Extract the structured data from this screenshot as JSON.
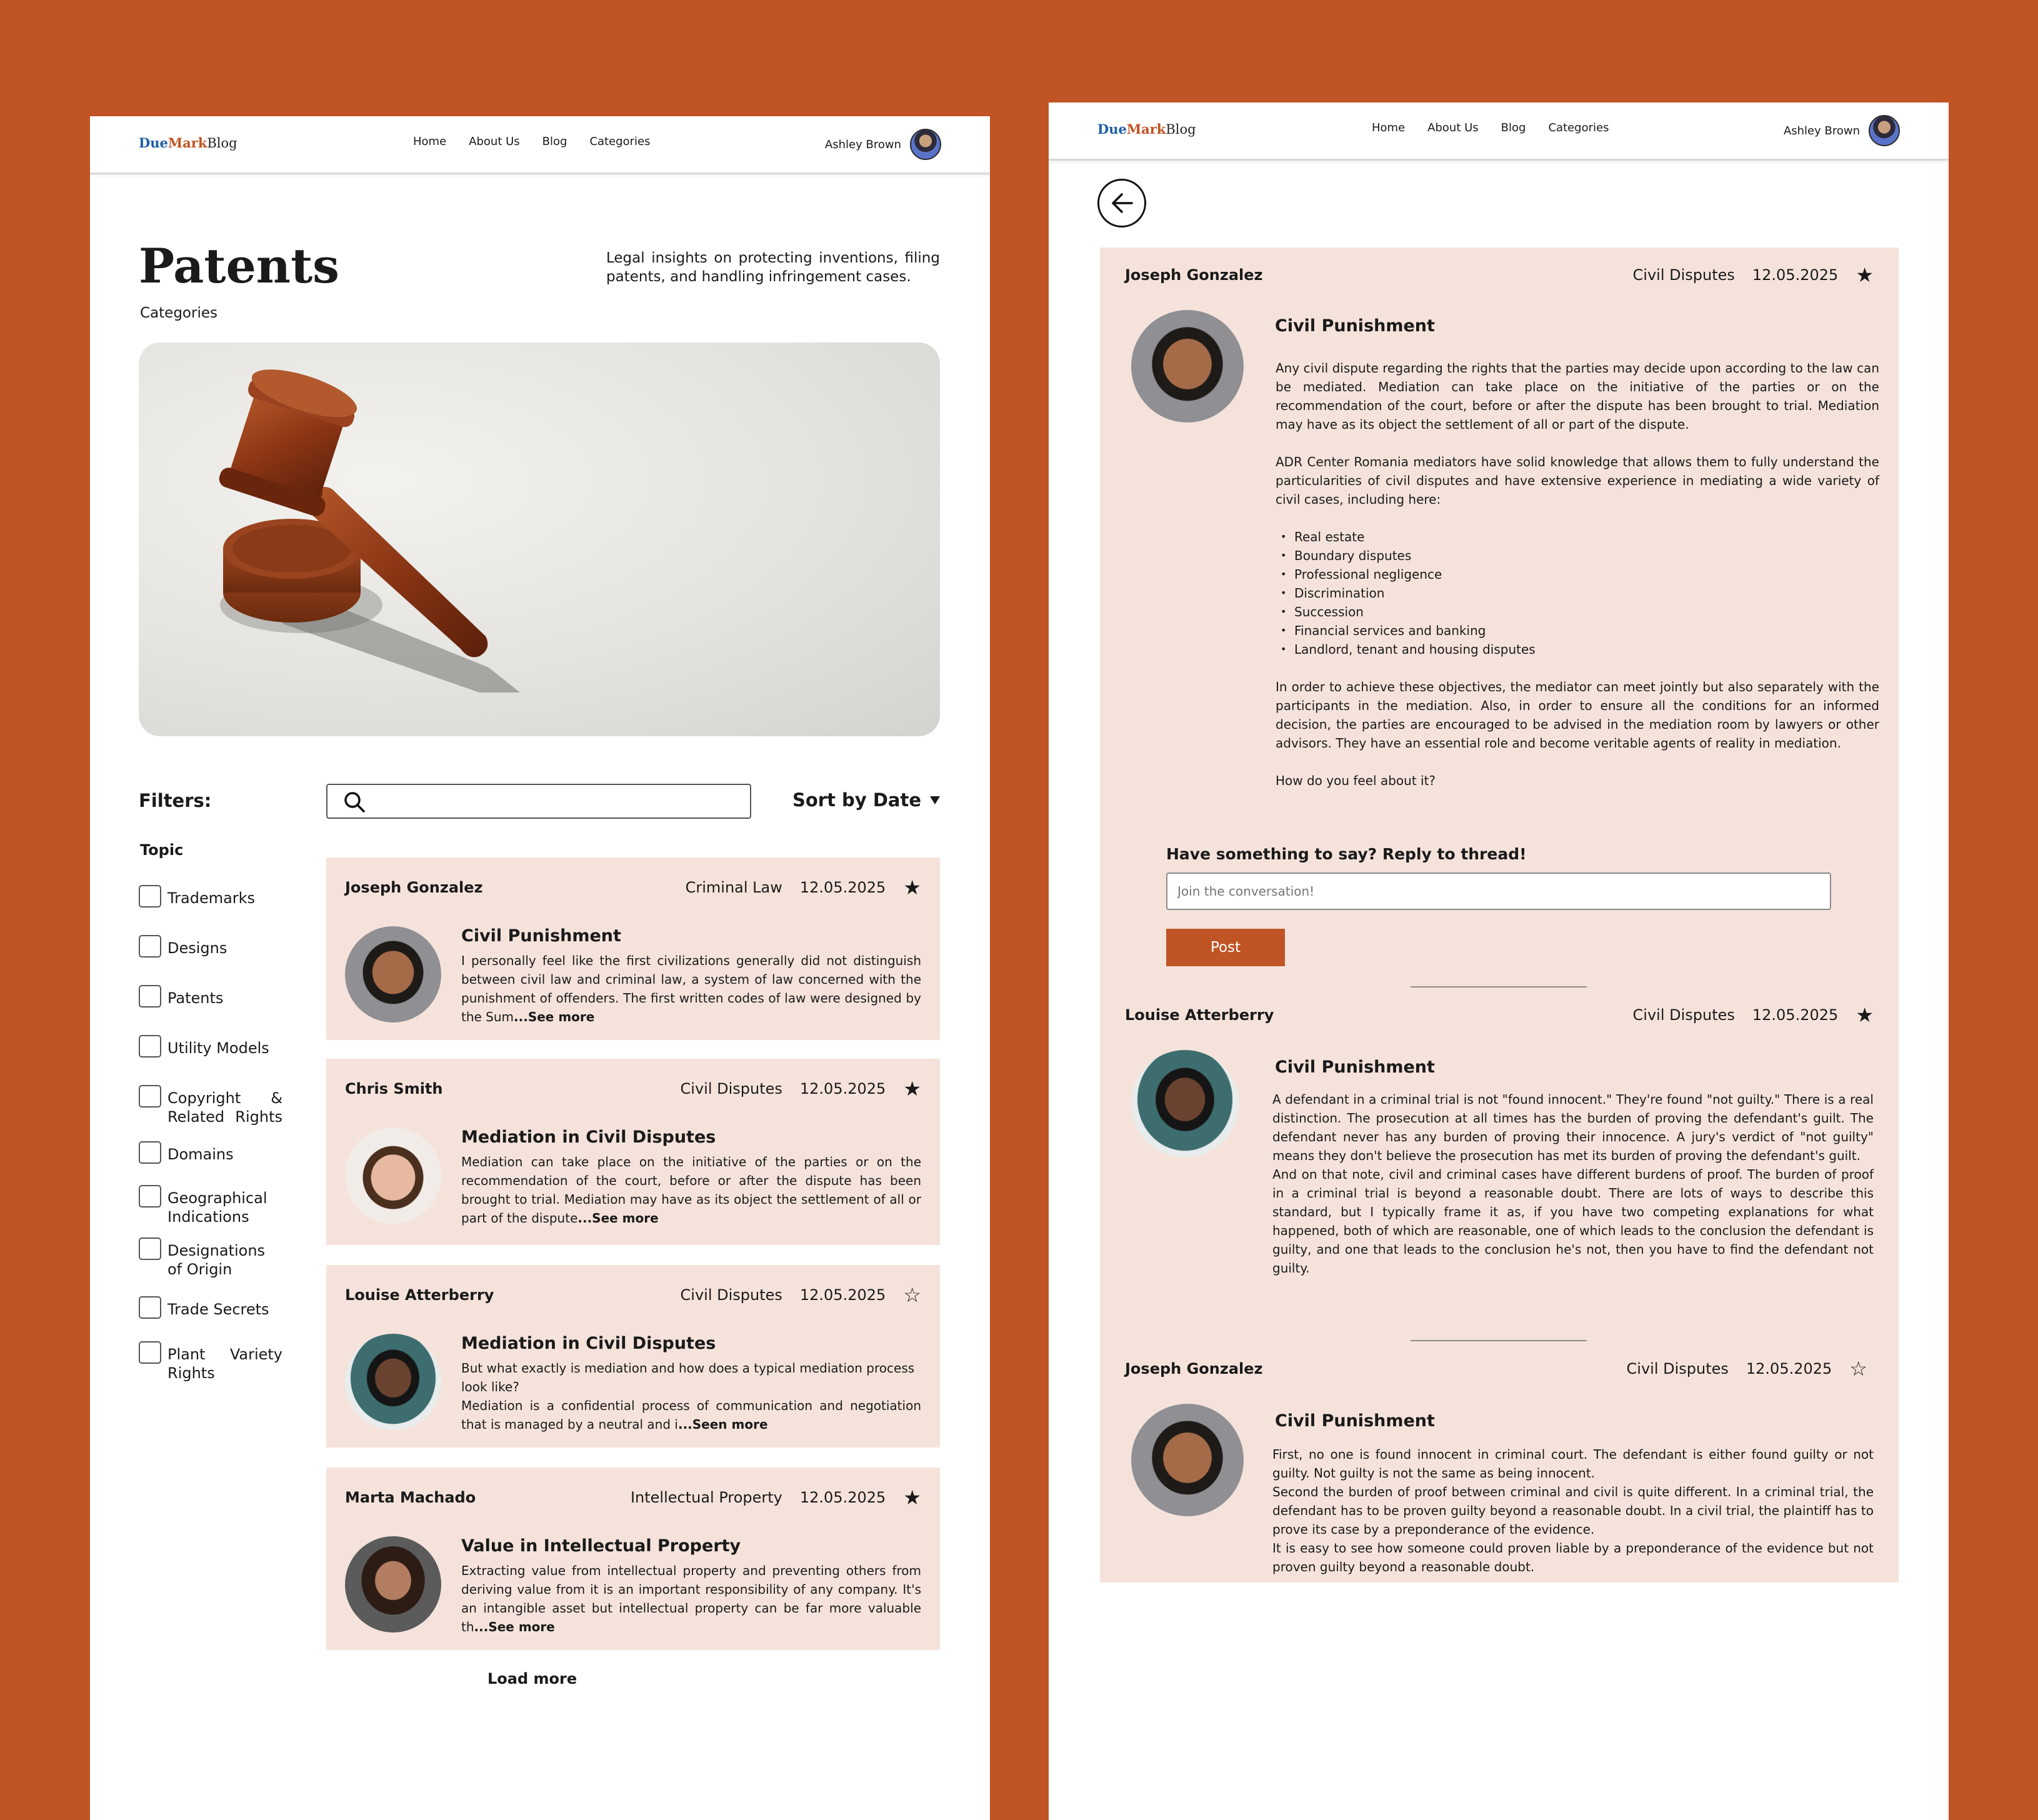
{
  "brand": {
    "part1": "Due",
    "part2": "Mark",
    "part3": "Blog"
  },
  "nav": {
    "items": [
      "Home",
      "About Us",
      "Blog",
      "Categories"
    ],
    "user": "Ashley Brown"
  },
  "list_page": {
    "title": "Patents",
    "subtitle": "Categories",
    "description": "Legal insights on protecting inventions, filing patents, and handling infringement cases.",
    "filters_label": "Filters:",
    "search": {
      "value": "",
      "placeholder": ""
    },
    "sort_label": "Sort by Date",
    "topic_label": "Topic",
    "topics": [
      "Trademarks",
      "Designs",
      "Patents",
      "Utility Models",
      "Copyright & Related Rights",
      "Domains",
      "Geographical Indications",
      "Designations of Origin",
      "Trade Secrets",
      "Plant Variety Rights"
    ],
    "cards": [
      {
        "author": "Joseph Gonzalez",
        "category": "Criminal Law",
        "date": "12.05.2025",
        "star": "★",
        "title": "Civil Punishment",
        "excerpt": "I personally feel like the first civilizations generally did not distinguish between civil law and criminal law, a system of law concerned with the punishment of offenders. The first written codes of law were designed by the Sum",
        "more": "...See more"
      },
      {
        "author": "Chris Smith",
        "category": "Civil Disputes",
        "date": "12.05.2025",
        "star": "★",
        "title": "Mediation in Civil Disputes",
        "excerpt": "Mediation can take place on the initiative of the parties or on the recommendation of the court, before or after the dispute has been brought to trial. Mediation may have as its object the settlement of all or part of the dispute",
        "more": "...See more"
      },
      {
        "author": "Louise Atterberry",
        "category": "Civil Disputes",
        "date": "12.05.2025",
        "star": "☆",
        "title": "Mediation in Civil Disputes",
        "excerpt1": "But what exactly is mediation and how does a typical mediation process look like?",
        "excerpt": "Mediation is a confidential process of communication and negotiation that is  managed by a neutral and i",
        "more": "...Seen more"
      },
      {
        "author": "Marta Machado",
        "category": "Intellectual Property",
        "date": "12.05.2025",
        "star": "★",
        "title": "Value in Intellectual Property",
        "excerpt": "Extracting value from intellectual property and preventing others from deriving value from it is an important responsibility of any company.  It's an intangible asset but intellectual property can be far more  valuable th",
        "more": "...See more"
      }
    ],
    "load_more": "Load more"
  },
  "thread_page": {
    "posts": [
      {
        "author": "Joseph Gonzalez",
        "category": "Civil Disputes",
        "date": "12.05.2025",
        "star": "★",
        "title": "Civil Punishment",
        "p1": "Any civil dispute regarding the rights that the parties may decide  upon according to the law can be mediated. Mediation can take place on  the initiative of the parties or on the recommendation of the court,  before or after the dispute has been brought to trial. Mediation may  have as its object the settlement of all or part of the dispute.",
        "p2": "ADR Center Romania mediators have solid knowledge that allows them to fully understand the particularities of civil disputes and have extensive  experience in mediating a wide variety of civil cases, including here:",
        "bullets": [
          "Real estate",
          "Boundary disputes",
          "Professional negligence",
          "Discrimination",
          "Succession",
          "Financial services and banking",
          "Landlord, tenant and housing disputes"
        ],
        "p3": "In order to achieve these objectives, the mediator can meet jointly but  also separately with the participants in the mediation. Also, in order  to ensure all the conditions for an informed decision, the parties are  encouraged to be advised in the mediation room by lawyers or other advisors. They have an essential role and become veritable agents of  reality in mediation.",
        "p4": "How do you feel about it?"
      },
      {
        "author": "Louise Atterberry",
        "category": "Civil Disputes",
        "date": "12.05.2025",
        "star": "★",
        "title": "Civil Punishment",
        "p1": " A defendant in a criminal trial is not \"found innocent.\" They're  found \"not guilty.\" There is a real distinction. The prosecution at all  times has the burden of proving the defendant's guilt. The defendant  never has any burden of proving their innocence. A jury's verdict of  \"not guilty\" means they don't believe the prosecution has met its burden of proving the defendant's guilt.",
        "p2": " And on that note, civil and criminal cases have different burdens  of proof. The burden of proof in a criminal trial is beyond a reasonable doubt. There are lots of ways to describe this standard, but I  typically frame it as, if you have two competing explanations for what happened, both of which are reasonable, one of which leads to the  conclusion the defendant is guilty, and one that leads to the conclusion he's not, then you have to find the defendant not guilty."
      },
      {
        "author": "Joseph Gonzalez",
        "category": "Civil Disputes",
        "date": "12.05.2025",
        "star": "☆",
        "title": "Civil Punishment",
        "p1": " First, no one is found innocent in criminal court. The defendant  is either found guilty or not guilty. Not guilty is not the same as  being innocent.",
        "p2": " Second the burden of proof between criminal and civil is quite  different. In a criminal trial, the defendant has to be proven guilty  beyond a reasonable doubt. In a civil trial, the plaintiff has to prove  its case by a preponderance of the evidence.",
        "p3": " It is easy to see how someone could proven liable by a  preponderance of the evidence but not proven guilty beyond a reasonable  doubt."
      }
    ],
    "reply": {
      "label": "Have something to say? Reply to thread!",
      "placeholder": "Join the conversation!",
      "value": "",
      "button": "Post"
    }
  },
  "colors": {
    "accent": "#C15424",
    "card_bg": "#F5E3DB",
    "logo_blue": "#1D5FA8"
  }
}
